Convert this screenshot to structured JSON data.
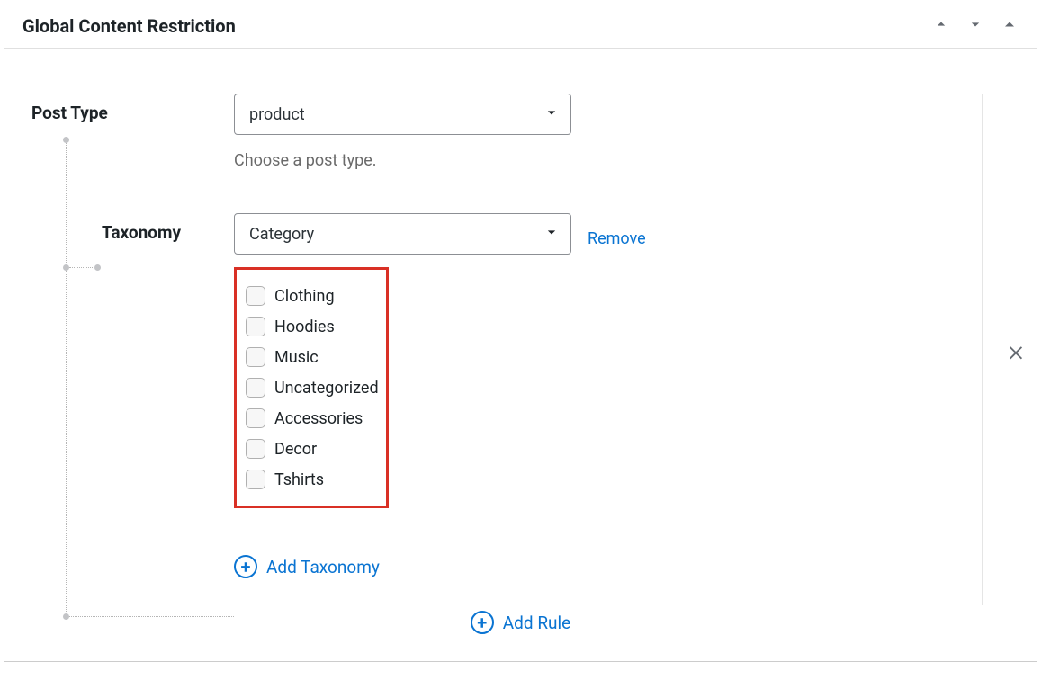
{
  "panel": {
    "title": "Global Content Restriction"
  },
  "post_type": {
    "label": "Post Type",
    "value": "product",
    "helper": "Choose a post type."
  },
  "taxonomy": {
    "label": "Taxonomy",
    "value": "Category",
    "remove_label": "Remove",
    "terms": [
      "Clothing",
      "Hoodies",
      "Music",
      "Uncategorized",
      "Accessories",
      "Decor",
      "Tshirts"
    ]
  },
  "actions": {
    "add_taxonomy": "Add Taxonomy",
    "add_rule": "Add Rule"
  }
}
